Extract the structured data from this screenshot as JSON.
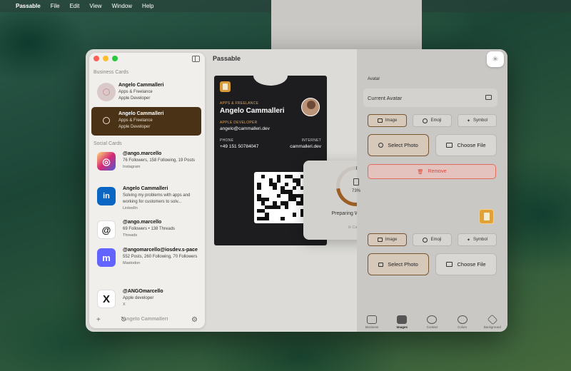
{
  "menubar": {
    "apple": "",
    "app": "Passable",
    "items": [
      "File",
      "Edit",
      "View",
      "Window",
      "Help"
    ]
  },
  "window": {
    "title": "Passable"
  },
  "sidebar": {
    "business_header": "Business Cards",
    "business": [
      {
        "name": "Angelo Cammalleri",
        "line1": "Apps & Freelance",
        "line2": "Apple Developer"
      },
      {
        "name": "Angelo Cammalleri",
        "line1": "Apps & Freelance",
        "line2": "Apple Developer"
      }
    ],
    "social_header": "Social Cards",
    "social": [
      {
        "name": "@ango.marcello",
        "desc": "76 Followers, 158 Following, 19 Posts",
        "platform": "Instagram",
        "icon": "instagram-icon",
        "color": "#d62976",
        "glyph": "◎"
      },
      {
        "name": "Angelo Cammalleri",
        "desc": "Solving my problems with apps and working for customers to solv...",
        "platform": "LinkedIn",
        "icon": "linkedin-icon",
        "color": "#0a66c2",
        "glyph": "in"
      },
      {
        "name": "@ango.marcello",
        "desc": "69 Followers • 138 Threads",
        "platform": "Threads",
        "icon": "threads-icon",
        "color": "#ffffff",
        "glyph": "@"
      },
      {
        "name": "@angomarcello@iosdev.s-pace",
        "desc": "552 Posts, 260 Following, 70 Followers",
        "platform": "Mastodon",
        "icon": "mastodon-icon",
        "color": "#6364ff",
        "glyph": "m"
      },
      {
        "name": "@ANGOmarcello",
        "desc": "Apple developer",
        "platform": "X",
        "icon": "x-icon",
        "color": "#ffffff",
        "glyph": "X"
      },
      {
        "name": "Angelo Cammalleri",
        "desc": "",
        "platform": "",
        "icon": "card-icon",
        "color": "#cfe0ee",
        "glyph": ""
      }
    ],
    "footer": {
      "add": "+",
      "refresh": "↻",
      "settings": "⚙"
    }
  },
  "pass": {
    "org": "APPS & FREELANCE",
    "name": "Angelo Cammalleri",
    "title_label": "APPLE DEVELOPER",
    "email": "angelo@cammalleri.dev",
    "phone_label": "PHONE",
    "phone": "+49 151 50784047",
    "internet_label": "INTERNET",
    "internet": "cammalleri.dev"
  },
  "progress": {
    "percent": "73%",
    "value": 0.73,
    "label": "Preparing Wallet Pass",
    "cancel": "Cancel"
  },
  "right": {
    "section": "Avatar",
    "current_avatar": "Current Avatar",
    "segments": [
      "Image",
      "Emoji",
      "Symbol"
    ],
    "select_photo": "Select Photo",
    "choose_file": "Choose File",
    "remove": "Remove"
  },
  "tabs": [
    {
      "label": "Business",
      "icon": "business-card-icon"
    },
    {
      "label": "Images",
      "icon": "images-icon"
    },
    {
      "label": "Contact",
      "icon": "compass-icon"
    },
    {
      "label": "Colors",
      "icon": "palette-icon"
    },
    {
      "label": "Background",
      "icon": "layers-icon"
    }
  ],
  "colors": {
    "accent": "#4a3217",
    "ring": "#9b5e24",
    "remove": "#e0443a"
  }
}
